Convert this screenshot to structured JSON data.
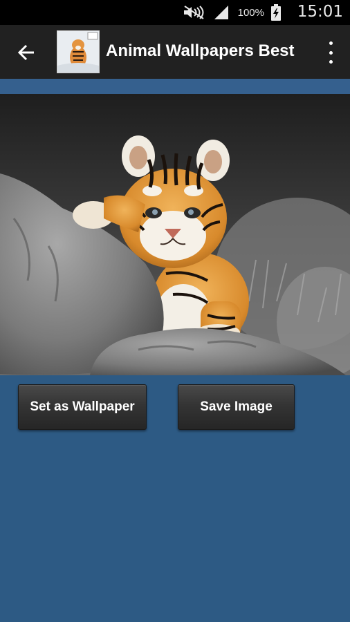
{
  "status_bar": {
    "battery_percent": "100%",
    "time": "15:01",
    "icons": [
      "mute-icon",
      "signal-icon",
      "battery-charging-icon"
    ]
  },
  "app_bar": {
    "title": "Animal Wallpapers Best",
    "back_icon": "back-arrow-icon",
    "menu_icon": "overflow-menu-icon"
  },
  "wallpaper": {
    "subject": "tiger cub on rocks"
  },
  "actions": {
    "set_wallpaper_label": "Set as Wallpaper",
    "save_image_label": "Save Image"
  },
  "colors": {
    "background": "#2d5a84",
    "app_bar": "#212121",
    "status_bar": "#000000",
    "button": "#343434"
  }
}
